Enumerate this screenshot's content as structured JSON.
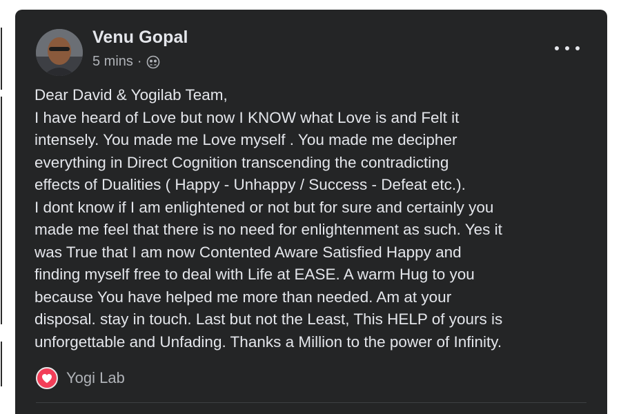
{
  "post": {
    "author": "Venu Gopal",
    "timestamp": "5 mins",
    "separator": "·",
    "audience_icon": "friends-icon",
    "more_icon": "more-options-icon",
    "body_lines": [
      "Dear David & Yogilab Team,",
      "I have heard of Love but now I KNOW what Love is and Felt it",
      "intensely. You made me Love myself . You made me decipher",
      "everything in Direct Cognition transcending the contradicting",
      "effects of Dualities ( Happy - Unhappy / Success - Defeat etc.).",
      "I dont know if I am enlightened or not but for sure and certainly you",
      "made me feel that there is no need for enlightenment as such. Yes it",
      "was True that I am now Contented Aware Satisfied Happy and",
      "finding myself free to deal with Life at EASE. A warm Hug to you",
      "because You have helped me more than needed. Am at your",
      "disposal. stay in touch. Last but not the Least, This HELP of yours is",
      "unforgettable and Unfading. Thanks a Million to the power of Infinity."
    ],
    "reaction": {
      "icon": "love-reaction-icon",
      "label": "Yogi Lab"
    }
  },
  "colors": {
    "card_background": "#242526",
    "primary_text": "#e4e6eb",
    "secondary_text": "#b0b3b8",
    "love_red": "#f33e58"
  }
}
